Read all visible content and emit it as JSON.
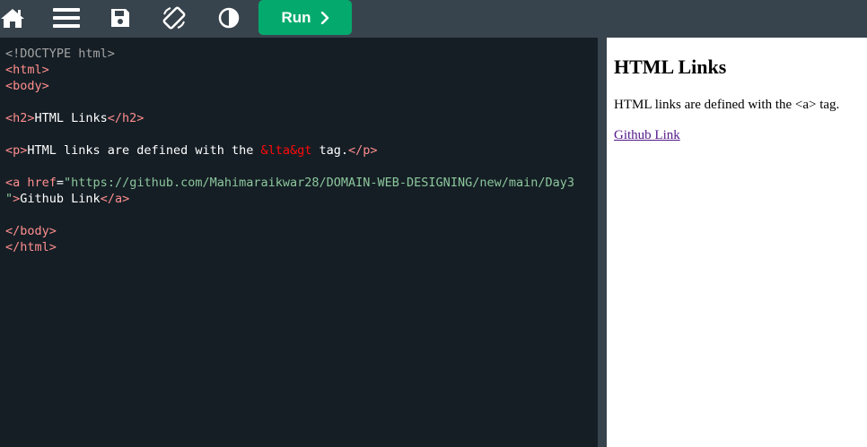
{
  "toolbar": {
    "icons": [
      "home-icon",
      "menu-icon",
      "save-icon",
      "rotate-icon",
      "contrast-icon"
    ],
    "run_label": "Run",
    "run_color": "#04aa6d",
    "bg_color": "#38444d"
  },
  "editor": {
    "lines": [
      [
        {
          "t": "doc",
          "v": "<!DOCTYPE html>"
        }
      ],
      [
        {
          "t": "tag",
          "v": "<html>"
        }
      ],
      [
        {
          "t": "tag",
          "v": "<body>"
        }
      ],
      [],
      [
        {
          "t": "tag",
          "v": "<h2>"
        },
        {
          "t": "text",
          "v": "HTML Links"
        },
        {
          "t": "tag",
          "v": "</h2>"
        }
      ],
      [],
      [
        {
          "t": "tag",
          "v": "<p>"
        },
        {
          "t": "text",
          "v": "HTML links are defined with the "
        },
        {
          "t": "ent",
          "v": "&lta&gt"
        },
        {
          "t": "text",
          "v": " tag."
        },
        {
          "t": "tag",
          "v": "</p>"
        }
      ],
      [],
      [
        {
          "t": "tag",
          "v": "<a "
        },
        {
          "t": "attr",
          "v": "href"
        },
        {
          "t": "text",
          "v": "="
        },
        {
          "t": "str",
          "v": "\"https://github.com/Mahimaraikwar28/DOMAIN-WEB-DESIGNING/new/main/Day3"
        }
      ],
      [
        {
          "t": "str",
          "v": "\""
        },
        {
          "t": "tag",
          "v": ">"
        },
        {
          "t": "text",
          "v": "Github Link"
        },
        {
          "t": "tag",
          "v": "</a>"
        }
      ],
      [],
      [
        {
          "t": "tag",
          "v": "</body>"
        }
      ],
      [
        {
          "t": "tag",
          "v": "</html>"
        }
      ]
    ]
  },
  "preview": {
    "heading": "HTML Links",
    "paragraph": "HTML links are defined with the <a> tag.",
    "link_text": "Github Link",
    "link_href": "https://github.com/Mahimaraikwar28/DOMAIN-WEB-DESIGNING/new/main/Day3"
  }
}
